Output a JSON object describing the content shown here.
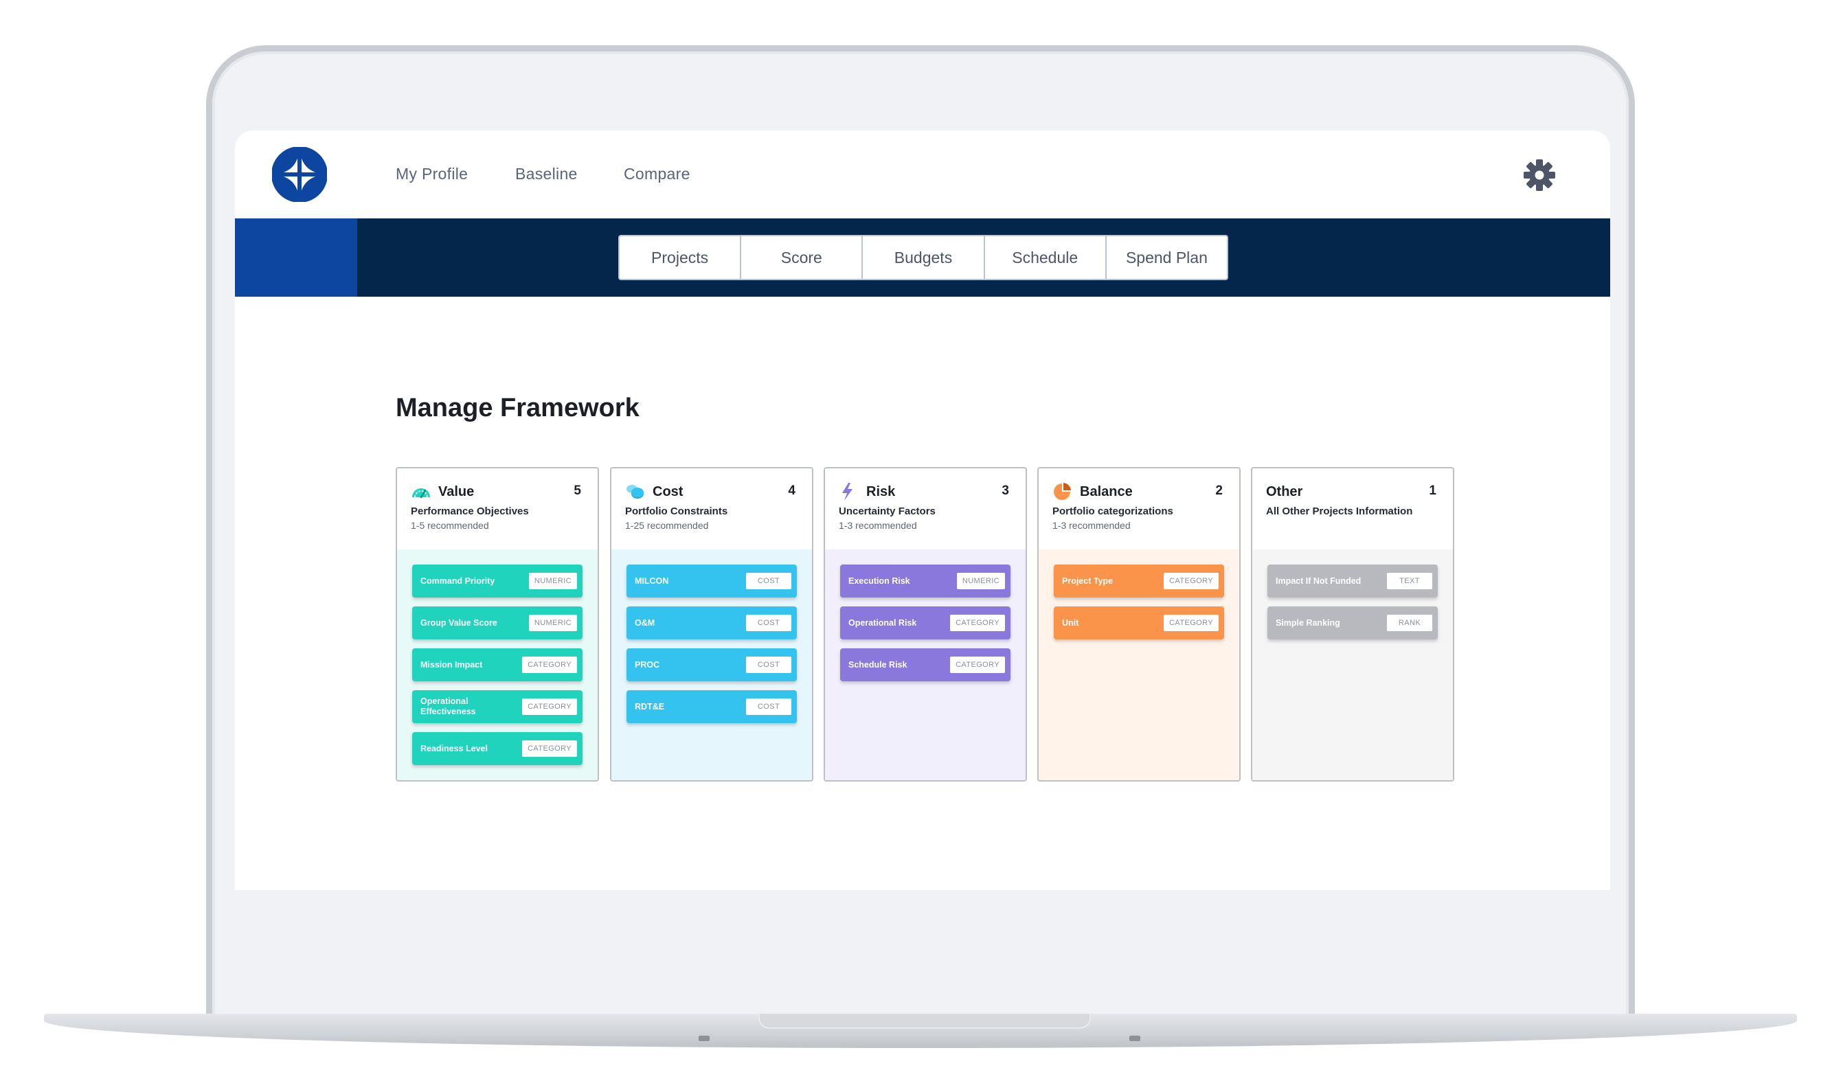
{
  "topnav": {
    "items": [
      "My Profile",
      "Baseline",
      "Compare"
    ]
  },
  "tabs": [
    "Projects",
    "Score",
    "Budgets",
    "Schedule",
    "Spend Plan"
  ],
  "page": {
    "title": "Manage Framework"
  },
  "colors": {
    "nav_dark": "#04264b",
    "nav_accent": "#0c46a0",
    "value": "#1fd3bd",
    "cost": "#34c3ef",
    "risk": "#8b78dc",
    "balance": "#fb944b",
    "other": "#b7b9bf"
  },
  "cards": [
    {
      "title": "Value",
      "count": "5",
      "icon": "speedometer-icon",
      "subtitle": "Performance Objectives",
      "recommended": "1-5 recommended",
      "factors": [
        {
          "name": "Command Priority",
          "tag": "NUMERIC"
        },
        {
          "name": "Group Value Score",
          "tag": "NUMERIC"
        },
        {
          "name": "Mission Impact",
          "tag": "CATEGORY"
        },
        {
          "name": "Operational Effectiveness",
          "tag": "CATEGORY"
        },
        {
          "name": "Readiness Level",
          "tag": "CATEGORY"
        }
      ]
    },
    {
      "title": "Cost",
      "count": "4",
      "icon": "coins-icon",
      "subtitle": "Portfolio Constraints",
      "recommended": "1-25 recommended",
      "factors": [
        {
          "name": "MILCON",
          "tag": "COST"
        },
        {
          "name": "O&M",
          "tag": "COST"
        },
        {
          "name": "PROC",
          "tag": "COST"
        },
        {
          "name": "RDT&E",
          "tag": "COST"
        }
      ]
    },
    {
      "title": "Risk",
      "count": "3",
      "icon": "lightning-icon",
      "subtitle": "Uncertainty Factors",
      "recommended": "1-3 recommended",
      "factors": [
        {
          "name": "Execution Risk",
          "tag": "NUMERIC"
        },
        {
          "name": "Operational Risk",
          "tag": "CATEGORY"
        },
        {
          "name": "Schedule Risk",
          "tag": "CATEGORY"
        }
      ]
    },
    {
      "title": "Balance",
      "count": "2",
      "icon": "pie-chart-icon",
      "subtitle": "Portfolio categorizations",
      "recommended": "1-3 recommended",
      "factors": [
        {
          "name": "Project Type",
          "tag": "CATEGORY"
        },
        {
          "name": "Unit",
          "tag": "CATEGORY"
        }
      ]
    },
    {
      "title": "Other",
      "count": "1",
      "icon": "",
      "subtitle": "All Other Projects Information",
      "recommended": "",
      "factors": [
        {
          "name": "Impact If Not Funded",
          "tag": "TEXT"
        },
        {
          "name": "Simple Ranking",
          "tag": "RANK"
        }
      ]
    }
  ]
}
